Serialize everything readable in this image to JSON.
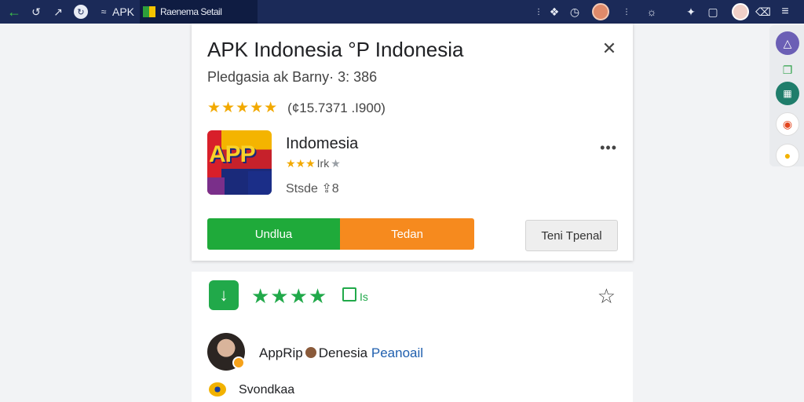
{
  "topbar": {
    "brand": "APK",
    "tab_title": "Raenema Setail"
  },
  "card": {
    "title": "APK Indonesia °P Indonesia",
    "subtitle": "Pledgasia ak Barny· 3: 386",
    "rating_stars": "★★★★★",
    "rating_text": "(¢15.7371 .I900)",
    "app": {
      "icon_text": "APP",
      "name": "Indomesia",
      "stars": "★★★",
      "stars_dim": "★",
      "stars_label": "Irk",
      "size": "Stsde ⇪8"
    },
    "buttons": {
      "primary": "Undlua",
      "secondary": "Tedan",
      "tertiary": "Teni Tpenal"
    }
  },
  "review_bar": {
    "stars": "★★★★",
    "label": "Is"
  },
  "comment": {
    "author": "AppRip",
    "text": "Denesia",
    "link": "Peanoail",
    "second_line": "Svondkaa"
  },
  "colors": {
    "topbar": "#1b2a58",
    "green": "#1faa3a",
    "orange": "#f68a1e",
    "star_gold": "#f2a900",
    "link_blue": "#1f5fae"
  }
}
